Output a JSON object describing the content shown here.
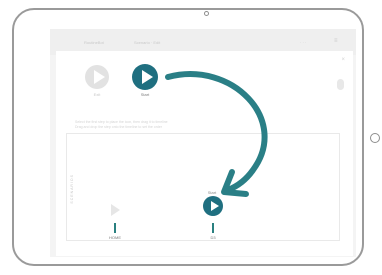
{
  "app": {
    "topbar_left": "RoutineBot",
    "topbar_center": "Scenario · Edit",
    "topbar_right": "· · ·"
  },
  "modal": {
    "close_label": "×",
    "buttons": [
      {
        "name": "Exit",
        "label": "Exit"
      },
      {
        "name": "Start",
        "label": "Start"
      }
    ],
    "field_lines": [
      "Select the first step to place the icon, then drag it to timeline",
      "Drag and drop the step onto the timeline to set the order"
    ],
    "timeline": {
      "vertical_label": "SCENARIOS",
      "marker_label_top": "Start",
      "steps": [
        {
          "label": "HOME"
        },
        {
          "label": "D3"
        }
      ]
    }
  },
  "colors": {
    "accent": "#1f6f80",
    "ghost": "#e6e6e6",
    "arrow": "#2a7f86"
  }
}
